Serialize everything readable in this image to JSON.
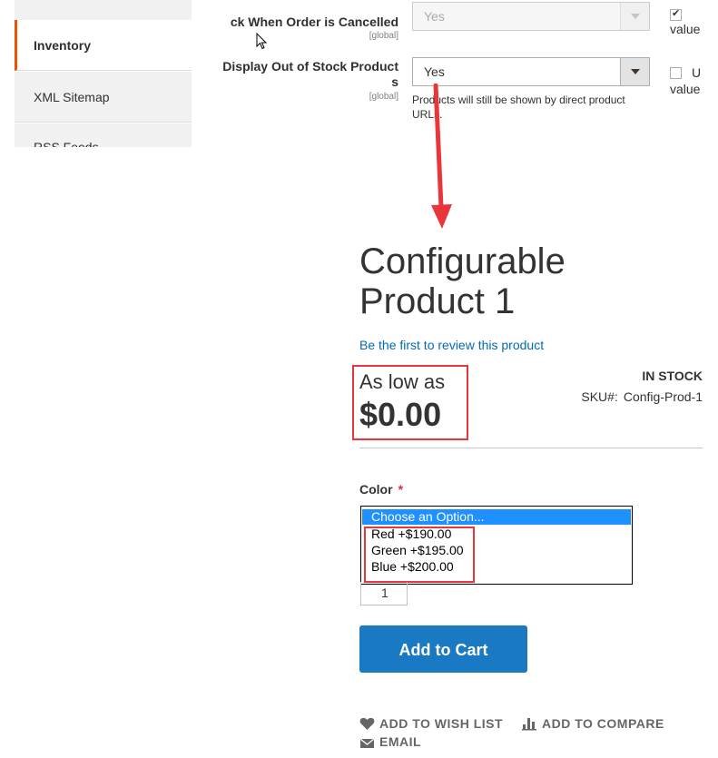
{
  "sidebar": {
    "items": [
      {
        "label": "Inventory"
      },
      {
        "label": "XML Sitemap"
      },
      {
        "label": "RSS Feeds"
      }
    ]
  },
  "config": {
    "row1": {
      "label": "ck When Order is Cancelled",
      "scope": "[global]",
      "value": "Yes",
      "checkbox_label": "Use system value"
    },
    "row2": {
      "label_line1": "Display Out of Stock Product",
      "label_line2": "s",
      "scope": "[global]",
      "value": "Yes",
      "note": "Products will still be shown by direct product URLs.",
      "checkbox_label": "Use system value"
    }
  },
  "product": {
    "title_line1": "Configurable",
    "title_line2": "Product 1",
    "review_link": "Be the first to review this product",
    "as_low_as": "As low as",
    "price": "$0.00",
    "stock": "IN STOCK",
    "sku_label": "SKU#:",
    "sku_value": "Config-Prod-1",
    "color_label": "Color",
    "required_mark": "*",
    "options": [
      "Choose an Option...",
      "Red +$190.00",
      "Green +$195.00",
      "Blue +$200.00"
    ],
    "qty": "1",
    "add_to_cart": "Add to Cart",
    "wish_list": "ADD TO WISH LIST",
    "compare": "ADD TO COMPARE",
    "email": "EMAIL"
  },
  "colors": {
    "accent": "#eb5202",
    "link": "#006bb4",
    "primary_button": "#1979c3",
    "highlight": "#e8363b",
    "selected_option": "#1e90ff"
  }
}
